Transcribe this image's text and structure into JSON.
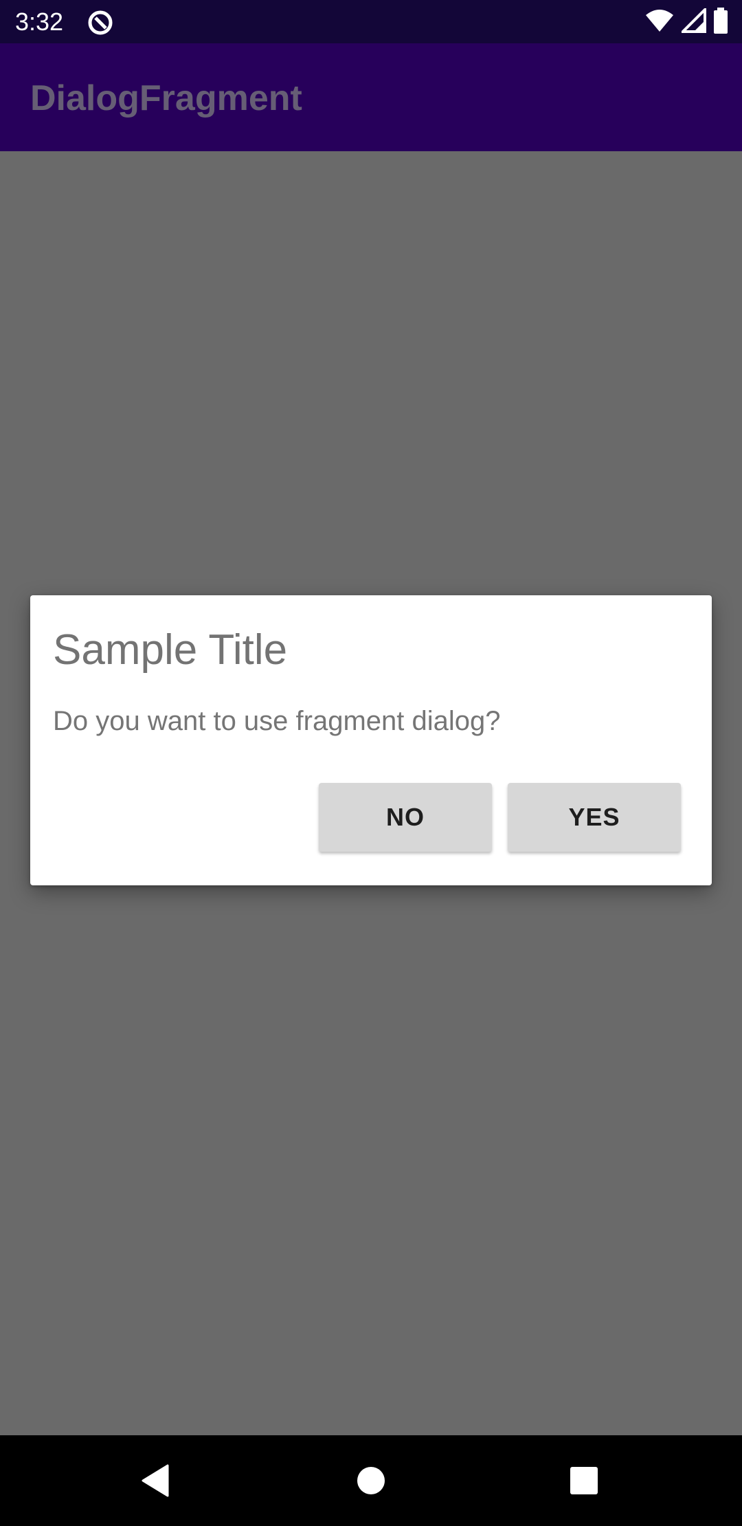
{
  "status_bar": {
    "time": "3:32",
    "icons": [
      "app-notification-icon",
      "wifi-icon",
      "signal-icon",
      "battery-icon"
    ]
  },
  "app_bar": {
    "title": "DialogFragment"
  },
  "dialog": {
    "title": "Sample Title",
    "message": "Do you want to use fragment dialog?",
    "negative_label": "NO",
    "positive_label": "YES"
  },
  "nav_bar": {
    "icons": [
      "back-icon",
      "home-icon",
      "recents-icon"
    ]
  },
  "colors": {
    "status_bar_bg": "#130638",
    "app_bar_bg": "#27005b",
    "scrim": "#6a6a6a",
    "dialog_bg": "#ffffff",
    "button_bg": "#d7d7d7",
    "nav_bar_bg": "#000000"
  }
}
